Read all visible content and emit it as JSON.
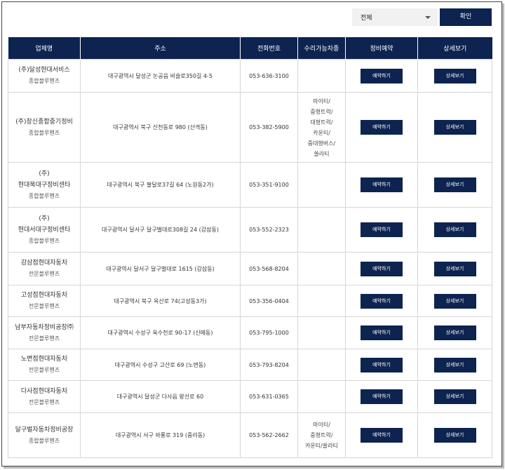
{
  "filter": {
    "selected": "전체",
    "confirm_label": "확인"
  },
  "table": {
    "headers": [
      "업체명",
      "주소",
      "전화번호",
      "수리가능차종",
      "정비예약",
      "상세보기"
    ],
    "reserve_label": "예약하기",
    "detail_label": "상세보기",
    "rows": [
      {
        "name_lines": [
          "(주)달성현대서비스"
        ],
        "type": "종합블루핸즈",
        "address": "대구광역시 달성군 논공읍 비슬로350길 4-5",
        "phone": "053-636-3100",
        "vehicles": []
      },
      {
        "name_lines": [
          "(주)창신종합중기정비"
        ],
        "type": "종합블루핸즈",
        "address": "대구광역시 북구 신천동로 980 (산격동)",
        "phone": "053-382-5900",
        "vehicles": [
          "마이티/",
          "중형트럭/",
          "대형트럭/",
          "카운티/",
          "중대형버스/",
          "쏠라티"
        ]
      },
      {
        "name_lines": [
          "(주)",
          "현대북대구정비센타"
        ],
        "type": "종합블루핸즈",
        "address": "대구광역시 북구 팔달로37길 64 (노원동2가)",
        "phone": "053-351-9100",
        "vehicles": []
      },
      {
        "name_lines": [
          "(주)",
          "현대서대구정비센타"
        ],
        "type": "종합블루핸즈",
        "address": "대구광역시 달서구 달구벌대로308길 24 (감삼동)",
        "phone": "053-552-2323",
        "vehicles": []
      },
      {
        "name_lines": [
          "감삼점현대자동차"
        ],
        "type": "전문블루핸즈",
        "address": "대구광역시 달서구 달구벌대로 1615 (감삼동)",
        "phone": "053-568-8204",
        "vehicles": []
      },
      {
        "name_lines": [
          "고성점현대자동차"
        ],
        "type": "전문블루핸즈",
        "address": "대구광역시 북구 옥산로 74(고성동3가)",
        "phone": "053-356-0404",
        "vehicles": []
      },
      {
        "name_lines": [
          "남부자동차정비공장㈜"
        ],
        "type": "전문블루핸즈",
        "address": "대구광역시 수성구 욱수천로 90-17 (신매동)",
        "phone": "053-795-1000",
        "vehicles": []
      },
      {
        "name_lines": [
          "노변점현대자동차"
        ],
        "type": "전문블루핸즈",
        "address": "대구광역시 수성구 고산로 69 (노변동)",
        "phone": "053-793-8204",
        "vehicles": []
      },
      {
        "name_lines": [
          "다사점현대자동차"
        ],
        "type": "전문블루핸즈",
        "address": "대구광역시 달성군 다사읍 왕선로 60",
        "phone": "053-631-0365",
        "vehicles": []
      },
      {
        "name_lines": [
          "달구벌자동차정비공장"
        ],
        "type": "종합블루핸즈",
        "address": "대구광역시 서구 와룡로 319 (중리동)",
        "phone": "053-562-2662",
        "vehicles": [
          "마이티/",
          "중형트럭/",
          "카운티/쏠라티"
        ]
      }
    ]
  }
}
